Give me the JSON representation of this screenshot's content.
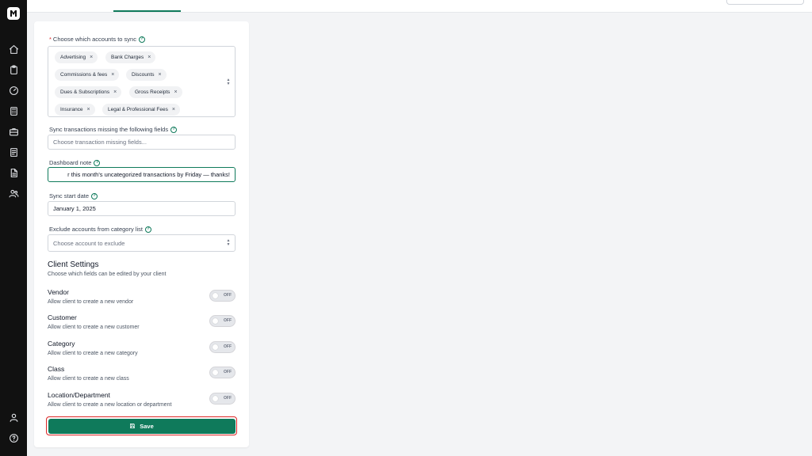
{
  "form": {
    "accounts_label": "Choose which accounts to sync",
    "required_mark": "*",
    "help_glyph": "?",
    "remove_glyph": "×",
    "accounts": [
      "Advertising",
      "Bank Charges",
      "Commissions & fees",
      "Discounts",
      "Dues & Subscriptions",
      "Gross Receipts",
      "Insurance",
      "Legal & Professional Fees"
    ],
    "missing_fields_label": "Sync transactions missing the following fields",
    "missing_fields_placeholder": "Choose transaction missing fields...",
    "note_label": "Dashboard note",
    "note_value": "r this month's uncategorized transactions by Friday — thanks!",
    "start_date_label": "Sync start date",
    "start_date_value": "January 1, 2025",
    "exclude_label": "Exclude accounts from category list",
    "exclude_placeholder": "Choose account to exclude"
  },
  "client_settings": {
    "title": "Client Settings",
    "subtitle": "Choose which fields can be edited by your client",
    "off_label": "OFF",
    "items": [
      {
        "name": "Vendor",
        "desc": "Allow client to create a new vendor",
        "enabled": false
      },
      {
        "name": "Customer",
        "desc": "Allow client to create a new customer",
        "enabled": false
      },
      {
        "name": "Category",
        "desc": "Allow client to create a new category",
        "enabled": false
      },
      {
        "name": "Class",
        "desc": "Allow client to create a new class",
        "enabled": false
      },
      {
        "name": "Location/Department",
        "desc": "Allow client to create a new location or department",
        "enabled": false
      }
    ]
  },
  "save_label": "Save",
  "sidebar": {
    "icons": [
      "home-icon",
      "clipboard-icon",
      "gauge-icon",
      "calculator-icon",
      "briefcase-icon",
      "ledger-icon",
      "document-icon",
      "users-icon",
      "user-icon",
      "help-circle-icon"
    ]
  },
  "colors": {
    "accent": "#0f7a5b",
    "sidebar": "#111111",
    "danger": "#dc2626"
  }
}
